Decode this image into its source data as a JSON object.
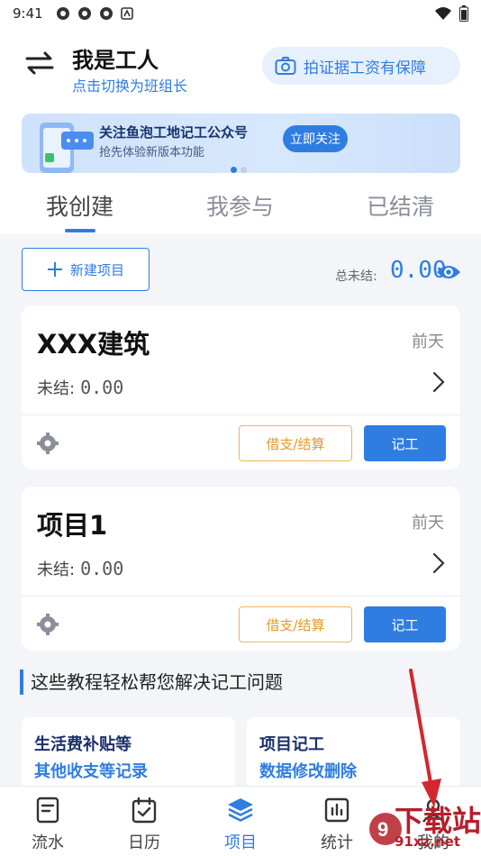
{
  "status_bar": {
    "time": "9:41"
  },
  "header": {
    "role_title": "我是工人",
    "role_switch_hint": "点击切换为班组长",
    "photo_button_label": "拍证据工资有保障"
  },
  "banner": {
    "title": "关注鱼泡工地记工公众号",
    "subtitle": "抢先体验新版本功能",
    "button_label": "立即关注"
  },
  "tabs": [
    {
      "label": "我创建",
      "active": true
    },
    {
      "label": "我参与",
      "active": false
    },
    {
      "label": "已结清",
      "active": false
    }
  ],
  "toolbar": {
    "new_project_label": "新建项目",
    "total_unsettled_label": "总未结:",
    "total_unsettled_value": "0.00"
  },
  "projects": [
    {
      "name": "XXX建筑",
      "date": "前天",
      "unsettled_label": "未结:",
      "unsettled_value": "0.00",
      "loan_button": "借支/结算",
      "record_button": "记工"
    },
    {
      "name": "项目1",
      "date": "前天",
      "unsettled_label": "未结:",
      "unsettled_value": "0.00",
      "loan_button": "借支/结算",
      "record_button": "记工"
    }
  ],
  "tutorials": {
    "heading": "这些教程轻松帮您解决记工问题",
    "cards": [
      {
        "line1": "生活费补贴等",
        "line2": "其他收支等记录"
      },
      {
        "line1": "项目记工",
        "line2": "数据修改删除"
      }
    ]
  },
  "bottom_nav": [
    {
      "label": "流水",
      "icon": "document-icon",
      "active": false
    },
    {
      "label": "日历",
      "icon": "calendar-icon",
      "active": false
    },
    {
      "label": "项目",
      "icon": "layers-icon",
      "active": true
    },
    {
      "label": "统计",
      "icon": "chart-icon",
      "active": false
    },
    {
      "label": "我的",
      "icon": "user-icon",
      "active": false
    }
  ],
  "watermark": {
    "line1": "下载站",
    "line2": "91xz.net"
  },
  "colors": {
    "accent": "#2f7de1",
    "warning": "#e39a2b",
    "watermark": "#b51f2a"
  }
}
